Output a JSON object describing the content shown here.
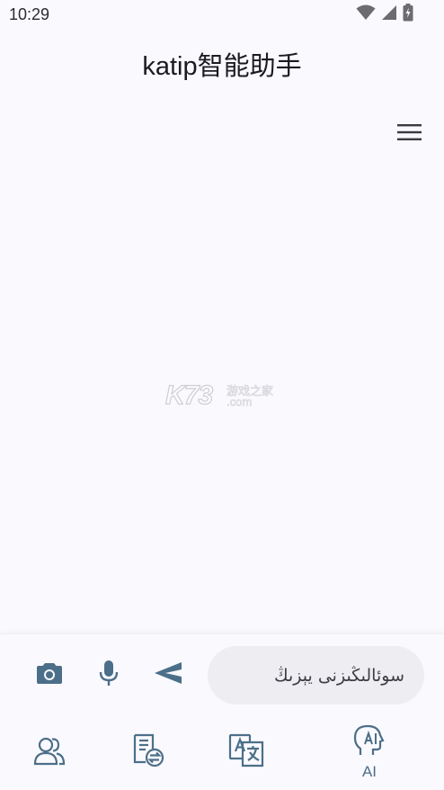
{
  "status_bar": {
    "time": "10:29",
    "icons": [
      "wifi-icon",
      "signal-icon",
      "battery-charging-icon"
    ]
  },
  "app_bar": {
    "title": "katip智能助手",
    "menu_icon": "hamburger-menu-icon"
  },
  "watermark": {
    "logo_text": "K73",
    "site_cn": "游戏之家",
    "site_domain": ".com"
  },
  "input_bar": {
    "camera_icon": "camera-icon",
    "mic_icon": "microphone-icon",
    "send_icon": "send-icon",
    "placeholder": "سوئالىڭىزنى يېزىڭ"
  },
  "bottom_nav": {
    "items": [
      {
        "icon": "contacts-icon",
        "label": ""
      },
      {
        "icon": "document-convert-icon",
        "label": ""
      },
      {
        "icon": "translate-icon",
        "label": ""
      },
      {
        "icon": "ai-assistant-icon",
        "label": "AI",
        "selected": true
      }
    ]
  },
  "colors": {
    "background": "#faf9fd",
    "accent": "#4c6f89",
    "input_background": "#eeedf2",
    "status_icon": "#6b6b70"
  }
}
